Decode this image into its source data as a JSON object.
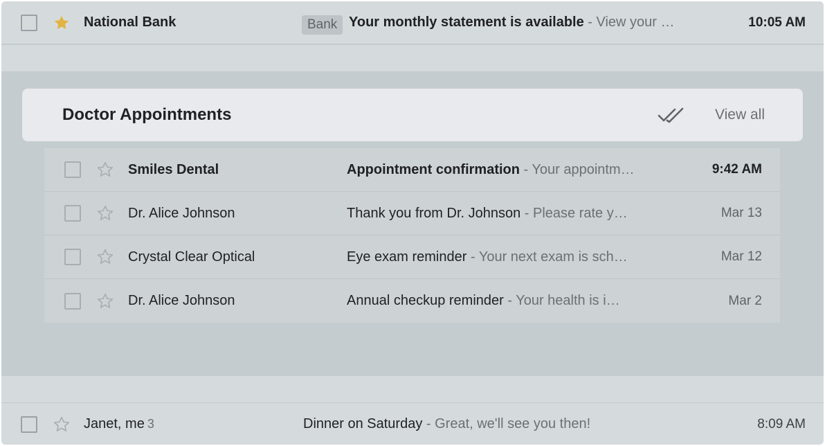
{
  "top_email": {
    "sender": "National Bank",
    "starred": true,
    "badge": "Bank",
    "subject": "Your monthly statement is available",
    "snippet": " - View your …",
    "time": "10:05 AM"
  },
  "group": {
    "title": "Doctor Appointments",
    "view_all": "View all",
    "emails": [
      {
        "sender": "Smiles Dental",
        "subject": "Appointment confirmation",
        "snippet": " - Your appointm…",
        "time": "9:42 AM",
        "unread": true
      },
      {
        "sender": "Dr. Alice Johnson",
        "subject": "Thank you from Dr. Johnson",
        "snippet": " - Please rate y…",
        "time": "Mar 13",
        "unread": false
      },
      {
        "sender": "Crystal Clear Optical",
        "subject": "Eye exam reminder",
        "snippet": " - Your next exam is sch…",
        "time": "Mar 12",
        "unread": false
      },
      {
        "sender": "Dr. Alice Johnson",
        "subject": "Annual checkup reminder",
        "snippet": " - Your health is i…",
        "time": "Mar 2",
        "unread": false
      }
    ]
  },
  "bottom_email": {
    "sender": "Janet, me",
    "count": "3",
    "subject": "Dinner on Saturday",
    "snippet": " - Great, we'll see you then!",
    "time": "8:09 AM"
  },
  "colors": {
    "star_filled": "#e3b341",
    "star_outline": "#a9afb3"
  }
}
